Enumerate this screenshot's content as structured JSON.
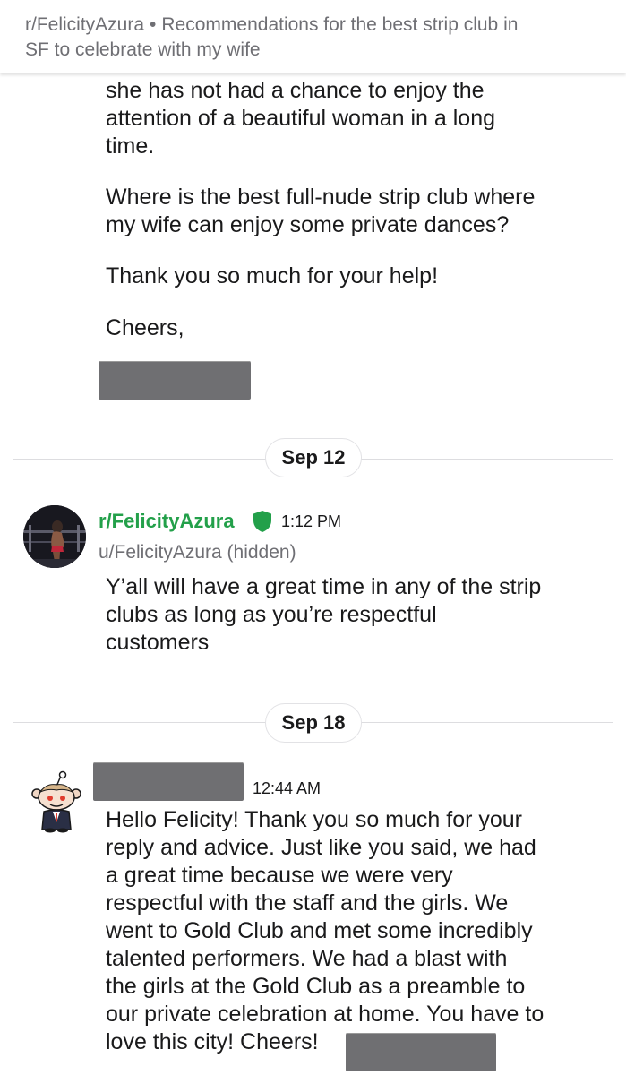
{
  "header": {
    "subreddit": "r/FelicityAzura",
    "separator": "•",
    "title_line1": "Recommendations for the best strip club in",
    "title_line2": "SF to celebrate with my wife"
  },
  "first_message": {
    "lines_a": [
      "she has not had a chance to enjoy the",
      "attention of a beautiful woman in a long",
      "time."
    ],
    "lines_b": [
      "Where is the best full-nude strip club where",
      "my wife can enjoy some private dances?"
    ],
    "line_c": "Thank you so much for your help!",
    "line_d": "Cheers,"
  },
  "dates": {
    "first": "Sep 12",
    "second": "Sep 18"
  },
  "reply": {
    "author": "r/FelicityAzura",
    "time": "1:12 PM",
    "sub_user": "u/FelicityAzura (hidden)",
    "lines": [
      "Y’all will have a great time in any of the strip",
      "clubs as long as you’re respectful",
      "customers"
    ]
  },
  "final_message": {
    "time": "12:44 AM",
    "lines": [
      "Hello Felicity! Thank you so much for your",
      "reply and advice. Just like you said, we had",
      "a great time because we were very",
      "respectful with the staff and the girls. We",
      "went to Gold Club and met some incredibly",
      "talented performers. We had a blast with",
      "the girls at the Gold Club as a preamble to",
      "our private celebration at home. You have to",
      "love this city! Cheers!"
    ]
  },
  "colors": {
    "accent_green": "#23a04a",
    "muted_text": "#6f6f74",
    "redaction": "#6f6f72"
  },
  "icons": {
    "mod_badge": "shield-icon",
    "avatar_default": "snoo-avatar-icon"
  }
}
